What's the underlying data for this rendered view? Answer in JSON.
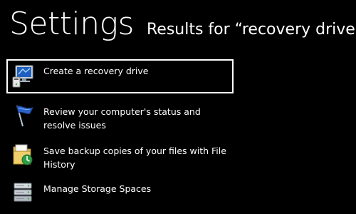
{
  "header": {
    "title": "Settings",
    "subtitle": "Results for “recovery drive”"
  },
  "results": [
    {
      "label": "Create a recovery drive",
      "icon": "recovery-drive-icon",
      "selected": true
    },
    {
      "label": "Review your computer's status and resolve issues",
      "icon": "action-center-flag-icon",
      "selected": false
    },
    {
      "label": "Save backup copies of your files with File History",
      "icon": "file-history-icon",
      "selected": false
    },
    {
      "label": "Manage Storage Spaces",
      "icon": "storage-spaces-icon",
      "selected": false
    }
  ],
  "colors": {
    "background": "#000000",
    "text": "#ffffff",
    "selection_border": "#ffffff"
  }
}
